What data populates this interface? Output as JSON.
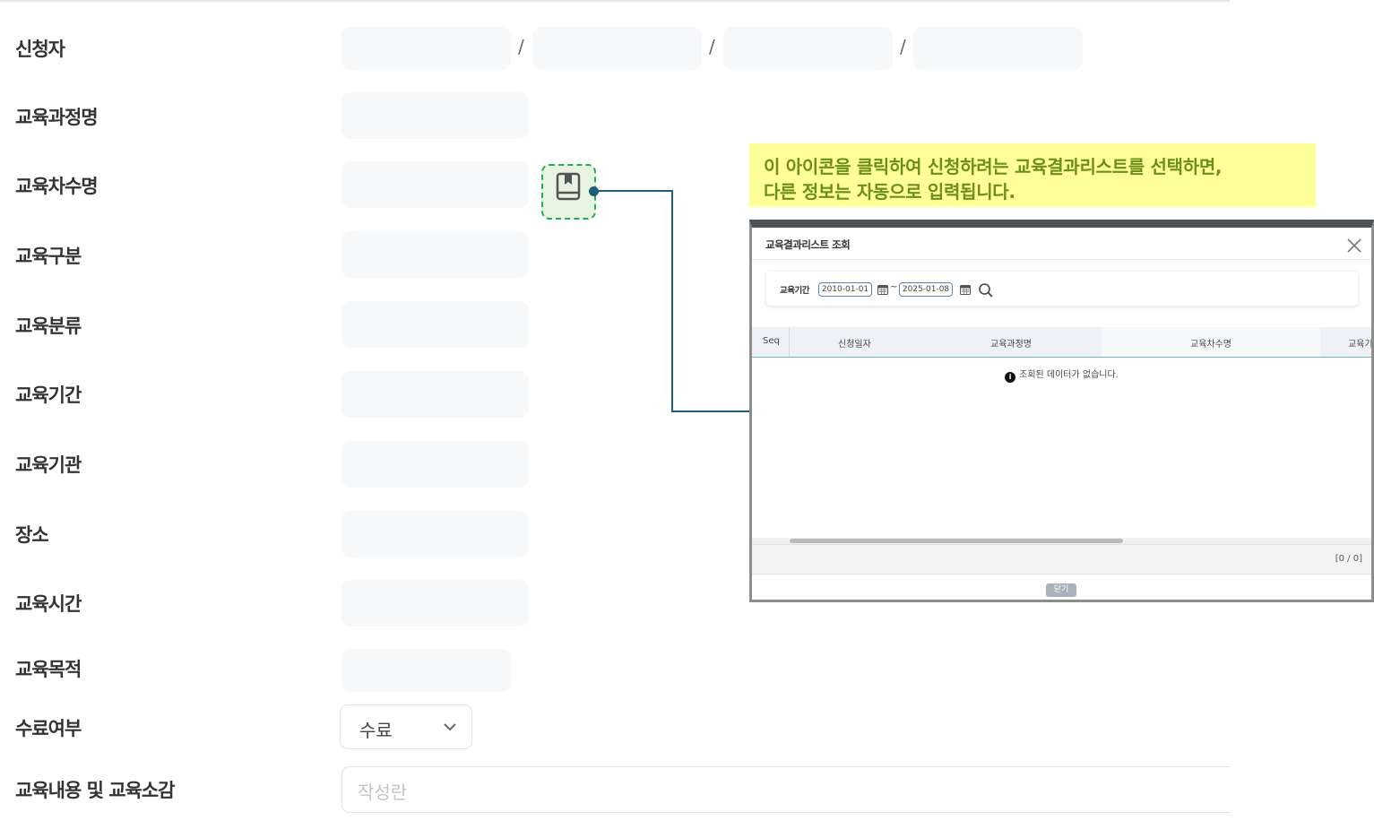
{
  "form": {
    "labels": {
      "applicant": "신청자",
      "course_name": "교육과정명",
      "session_name": "교육차수명",
      "category": "교육구분",
      "classification": "교육분류",
      "period": "교육기간",
      "institution": "교육기관",
      "location": "장소",
      "hours": "교육시간",
      "purpose": "교육목적",
      "completion": "수료여부",
      "content": "교육내용 및 교육소감"
    },
    "applicant_separator": "/",
    "completion_value": "수료",
    "content_placeholder": "작성란"
  },
  "callout": {
    "line1": "이 아이콘을 클릭하여 신청하려는 교육결과리스트를 선택하면,",
    "line2": "다른 정보는 자동으로 입력됩니다."
  },
  "icons": {
    "book": "book-icon",
    "close": "close-icon",
    "calendar": "calendar-icon",
    "search": "search-icon",
    "chevron": "chevron-down-icon",
    "info": "info-icon"
  },
  "colors": {
    "callout_bg": "#ffff99",
    "callout_text": "#6c8f16",
    "highlight_border": "#22b04b",
    "connector": "#1f5f7a"
  },
  "popup": {
    "title": "교육결과리스트 조회",
    "search_label": "교육기간",
    "date_from": "2010-01-01",
    "date_separator": "~",
    "date_to": "2025-01-08",
    "columns": [
      "Seq",
      "신청일자",
      "교육과정명",
      "교육차수명",
      "교육기"
    ],
    "info_glyph": "i",
    "no_data": "조회된 데이터가 없습니다.",
    "count": "[0 / 0]",
    "close_button": "닫기"
  }
}
